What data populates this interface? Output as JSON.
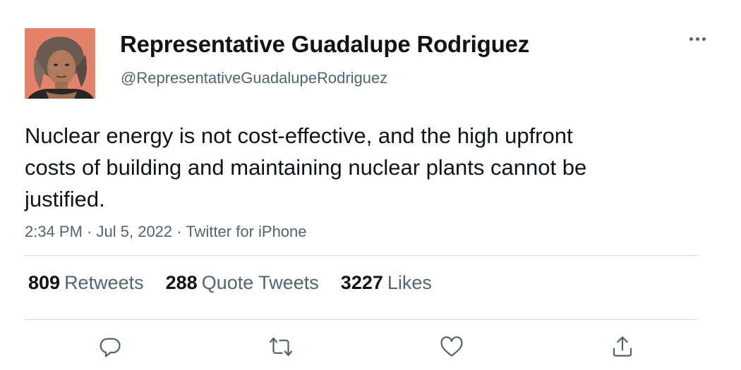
{
  "author": {
    "name": "Representative Guadalupe Rodriguez",
    "handle": "@RepresentativeGuadalupeRodriguez"
  },
  "tweet": {
    "text": "Nuclear energy is not cost-effective, and the high upfront costs of building and maintaining nuclear plants cannot be justified.",
    "time": "2:34 PM",
    "date": "Jul 5, 2022",
    "source": "Twitter for iPhone"
  },
  "stats": {
    "retweets": {
      "count": "809",
      "label": "Retweets"
    },
    "quotes": {
      "count": "288",
      "label": "Quote Tweets"
    },
    "likes": {
      "count": "3227",
      "label": "Likes"
    }
  },
  "icons": {
    "more": "more-icon",
    "reply": "reply-icon",
    "retweet": "retweet-icon",
    "like": "like-icon",
    "share": "share-icon"
  },
  "colors": {
    "text": "#0f1419",
    "secondary": "#536471",
    "divider": "#cfd9de"
  }
}
